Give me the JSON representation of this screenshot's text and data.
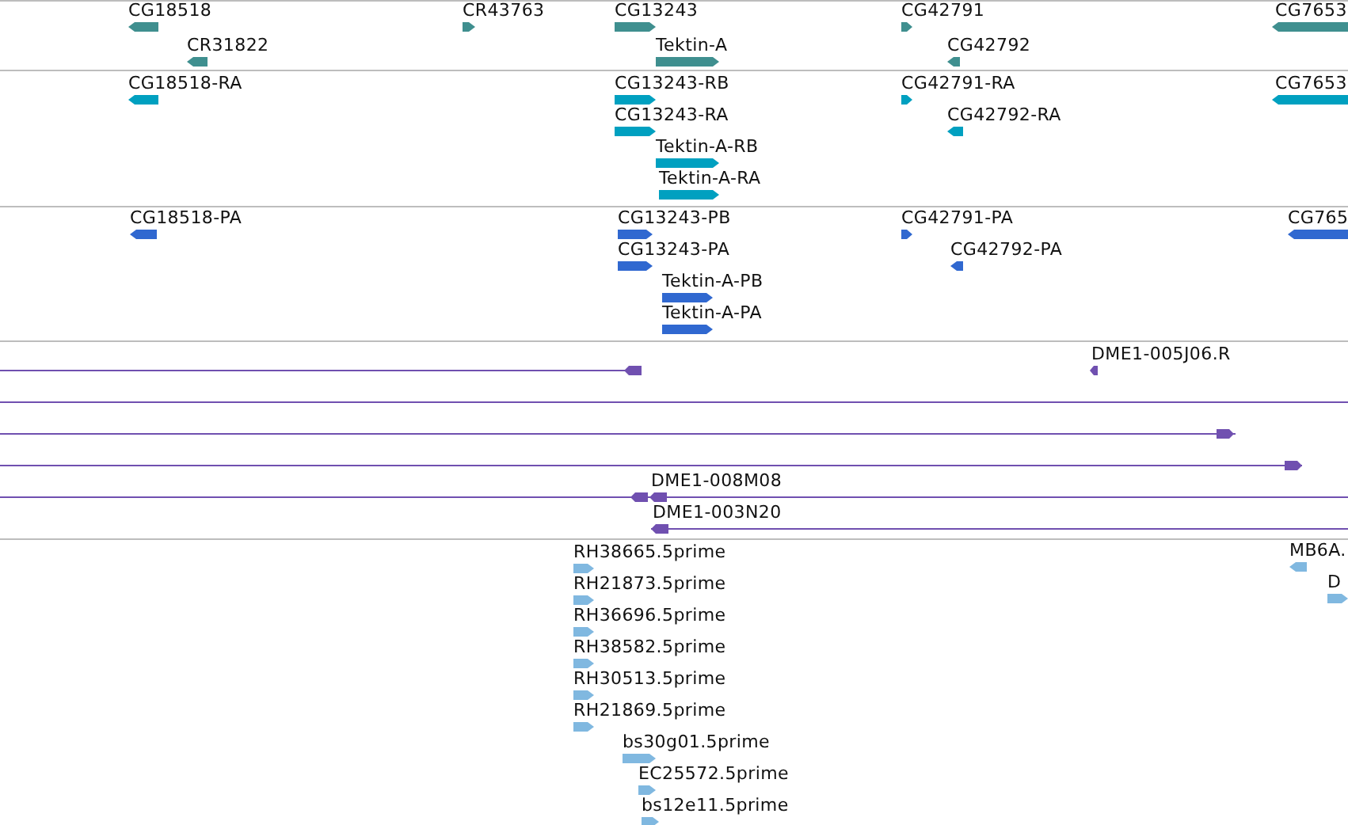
{
  "tracks": [
    {
      "color": "#3f8f8f",
      "features": [
        {
          "label": "CG18518",
          "reverse": true,
          "kind": "block"
        },
        {
          "label": "CR31822",
          "reverse": true,
          "kind": "block"
        },
        {
          "label": "CR43763",
          "reverse": false,
          "kind": "block"
        },
        {
          "label": "CG13243",
          "reverse": false,
          "kind": "block"
        },
        {
          "label": "Tektin-A",
          "reverse": false,
          "kind": "block"
        },
        {
          "label": "CG42791",
          "reverse": false,
          "kind": "block"
        },
        {
          "label": "CG42792",
          "reverse": true,
          "kind": "block"
        },
        {
          "label": "CG7653",
          "reverse": true,
          "kind": "block"
        }
      ]
    },
    {
      "color": "#00a0c0",
      "features": [
        {
          "label": "CG18518-RA",
          "reverse": true,
          "kind": "block"
        },
        {
          "label": "CG13243-RB",
          "reverse": false,
          "kind": "block"
        },
        {
          "label": "CG13243-RA",
          "reverse": false,
          "kind": "block"
        },
        {
          "label": "Tektin-A-RB",
          "reverse": false,
          "kind": "block"
        },
        {
          "label": "Tektin-A-RA",
          "reverse": false,
          "kind": "block"
        },
        {
          "label": "CG42791-RA",
          "reverse": false,
          "kind": "block"
        },
        {
          "label": "CG42792-RA",
          "reverse": true,
          "kind": "block"
        },
        {
          "label": "CG7653",
          "reverse": true,
          "kind": "block"
        }
      ]
    },
    {
      "color": "#3068d0",
      "features": [
        {
          "label": "CG18518-PA",
          "reverse": true,
          "kind": "block"
        },
        {
          "label": "CG13243-PB",
          "reverse": false,
          "kind": "block"
        },
        {
          "label": "CG13243-PA",
          "reverse": false,
          "kind": "block"
        },
        {
          "label": "Tektin-A-PB",
          "reverse": false,
          "kind": "block"
        },
        {
          "label": "Tektin-A-PA",
          "reverse": false,
          "kind": "block"
        },
        {
          "label": "CG42791-PA",
          "reverse": false,
          "kind": "block"
        },
        {
          "label": "CG42792-PA",
          "reverse": true,
          "kind": "block"
        },
        {
          "label": "CG765",
          "reverse": true,
          "kind": "block"
        }
      ]
    },
    {
      "color": "#7050b0",
      "features": [
        {
          "reverse": true,
          "kind": "line"
        },
        {
          "label": "DME1-005J06.R",
          "reverse": true,
          "kind": "block"
        },
        {
          "kind": "plain"
        },
        {
          "reverse": false,
          "kind": "line"
        },
        {
          "reverse": false,
          "kind": "line"
        },
        {
          "reverse": true,
          "kind": "line"
        },
        {
          "label": "DME1-008M08",
          "reverse": true,
          "kind": "line"
        },
        {
          "label": "DME1-003N20",
          "reverse": true,
          "kind": "line"
        }
      ]
    },
    {
      "color": "#80b8e0",
      "features": [
        {
          "label": "RH38665.5prime",
          "reverse": false,
          "kind": "block"
        },
        {
          "label": "RH21873.5prime",
          "reverse": false,
          "kind": "block"
        },
        {
          "label": "RH36696.5prime",
          "reverse": false,
          "kind": "block"
        },
        {
          "label": "RH38582.5prime",
          "reverse": false,
          "kind": "block"
        },
        {
          "label": "RH30513.5prime",
          "reverse": false,
          "kind": "block"
        },
        {
          "label": "RH21869.5prime",
          "reverse": false,
          "kind": "block"
        },
        {
          "label": "bs30g01.5prime",
          "reverse": false,
          "kind": "block"
        },
        {
          "label": "EC25572.5prime",
          "reverse": false,
          "kind": "block"
        },
        {
          "label": "bs12e11.5prime",
          "reverse": false,
          "kind": "block"
        },
        {
          "label": "MB6A.",
          "reverse": true,
          "kind": "block"
        },
        {
          "label": "D",
          "reverse": false,
          "kind": "block"
        }
      ]
    }
  ]
}
